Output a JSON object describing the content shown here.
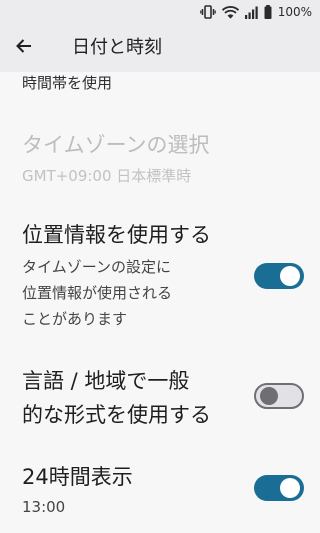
{
  "status_bar": {
    "battery_text": "100%",
    "icons": [
      "vibrate-icon",
      "wifi-icon",
      "signal-icon",
      "battery-icon"
    ]
  },
  "app_bar": {
    "back_icon": "arrow-back-icon",
    "title": "日付と時刻"
  },
  "partial_item": {
    "label": "時間帯を使用"
  },
  "settings": [
    {
      "title": "タイムゾーンの選択",
      "summary": "GMT+09:00 日本標準時",
      "enabled": false
    },
    {
      "title": "位置情報を使用する",
      "summary_lines": [
        "タイムゾーンの設定に",
        "位置情報が使用される",
        "ことがあります"
      ],
      "toggle": "on"
    },
    {
      "title_lines": [
        "言語 / 地域で一般",
        "的な形式を使用する"
      ],
      "toggle": "off"
    },
    {
      "title": "24時間表示",
      "summary": "13:00",
      "toggle": "on"
    }
  ],
  "colors": {
    "background": "#f7f7f8",
    "app_bar": "#ececef",
    "switch_on": "#1a6e95",
    "switch_off_track": "#e2e2e6",
    "switch_off_border": "#6f6f73",
    "disabled_text": "#bdbdbd"
  }
}
